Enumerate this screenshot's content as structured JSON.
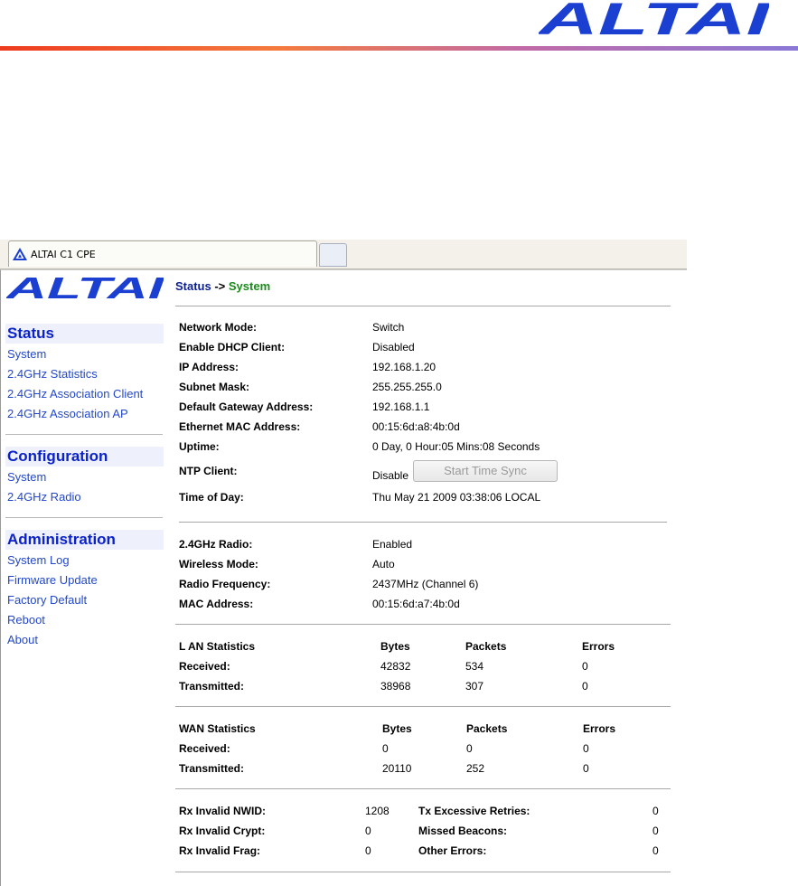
{
  "doc_brand": "ALTAI",
  "tab": {
    "title": "ALTAI C1 CPE"
  },
  "sidebar": {
    "logo": "ALTAI",
    "sections": [
      {
        "title": "Status",
        "items": [
          "System",
          "2.4GHz Statistics",
          "2.4GHz Association Client",
          "2.4GHz Association AP"
        ]
      },
      {
        "title": "Configuration",
        "items": [
          "System",
          "2.4GHz Radio"
        ]
      },
      {
        "title": "Administration",
        "items": [
          "System Log",
          "Firmware Update",
          "Factory Default",
          "Reboot",
          "About"
        ]
      }
    ]
  },
  "breadcrumb": {
    "section": "Status",
    "sep": " -> ",
    "page": "System"
  },
  "system": [
    {
      "label": "Network Mode:",
      "value": "Switch"
    },
    {
      "label": "Enable DHCP Client:",
      "value": "Disabled"
    },
    {
      "label": "IP Address:",
      "value": "192.168.1.20"
    },
    {
      "label": "Subnet Mask:",
      "value": "255.255.255.0"
    },
    {
      "label": "Default Gateway Address:",
      "value": "192.168.1.1"
    },
    {
      "label": "Ethernet MAC Address:",
      "value": "00:15:6d:a8:4b:0d"
    },
    {
      "label": "Uptime:",
      "value": "0 Day, 0 Hour:05 Mins:08 Seconds"
    },
    {
      "label": "NTP Client:",
      "value": "Disable"
    },
    {
      "label": "Time of Day:",
      "value": "Thu May 21 2009 03:38:06 LOCAL"
    }
  ],
  "ntp_button": "Start Time Sync",
  "radio": [
    {
      "label": "2.4GHz Radio:",
      "value": "Enabled"
    },
    {
      "label": "Wireless Mode:",
      "value": "Auto"
    },
    {
      "label": "Radio Frequency:",
      "value": "2437MHz (Channel 6)"
    },
    {
      "label": "MAC Address:",
      "value": "00:15:6d:a7:4b:0d"
    }
  ],
  "lan": {
    "title": "L AN Statistics",
    "headers": [
      "Bytes",
      "Packets",
      "Errors"
    ],
    "rows": [
      {
        "label": "Received:",
        "values": [
          "42832",
          "534",
          "0"
        ]
      },
      {
        "label": "Transmitted:",
        "values": [
          "38968",
          "307",
          "0"
        ]
      }
    ]
  },
  "wan": {
    "title": "WAN Statistics",
    "headers": [
      "Bytes",
      "Packets",
      "Errors"
    ],
    "rows": [
      {
        "label": "Received:",
        "values": [
          "0",
          "0",
          "0"
        ]
      },
      {
        "label": "Transmitted:",
        "values": [
          "20110",
          "252",
          "0"
        ]
      }
    ]
  },
  "wireless_errors": [
    {
      "label": "Rx Invalid NWID:",
      "value": "1208",
      "label2": "Tx Excessive Retries:",
      "value2": "0"
    },
    {
      "label": "Rx Invalid Crypt:",
      "value": "0",
      "label2": "Missed Beacons:",
      "value2": "0"
    },
    {
      "label": "Rx Invalid Frag:",
      "value": "0",
      "label2": "Other Errors:",
      "value2": "0"
    }
  ],
  "colors": {
    "link": "#2247c9",
    "heading": "#0b22c9",
    "logo": "#1b3fd0",
    "crumb_page": "#1c8a1c"
  }
}
